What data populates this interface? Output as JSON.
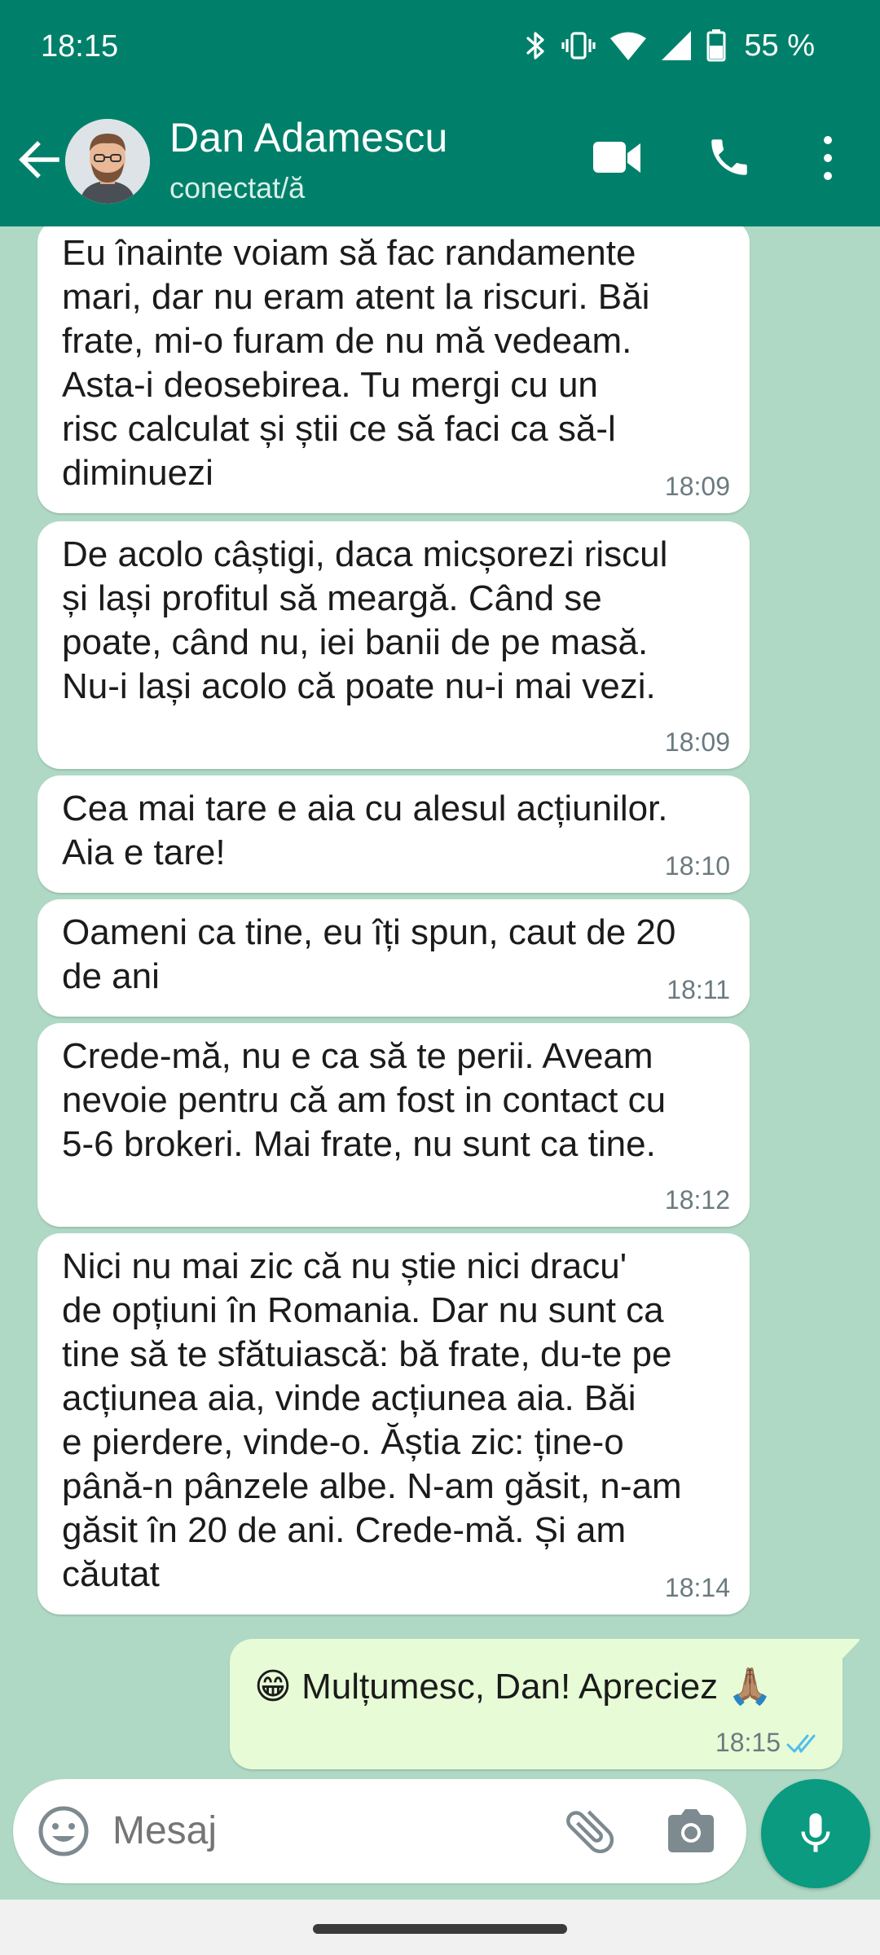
{
  "status_bar": {
    "time": "18:15",
    "battery": "55 %",
    "icons": [
      "bluetooth-icon",
      "vibrate-icon",
      "wifi-icon",
      "cell-signal-icon",
      "battery-icon"
    ]
  },
  "header": {
    "contact_name": "Dan Adamescu",
    "contact_status": "conectat/ă",
    "icons": [
      "back-arrow-icon",
      "avatar",
      "video-call-icon",
      "phone-icon",
      "more-vert-icon"
    ]
  },
  "messages": [
    {
      "direction": "incoming",
      "text": "Eu înainte voiam să fac randamente\nmari, dar nu eram atent la riscuri. Băi\nfrate, mi-o furam de nu mă vedeam.\nAsta-i deosebirea. Tu mergi cu un\nrisc calculat și știi ce să faci ca să-l\ndiminuezi",
      "time": "18:09"
    },
    {
      "direction": "incoming",
      "text": "De acolo câștigi, daca micșorezi riscul\nși lași profitul să meargă. Când se\npoate, când nu, iei banii de pe masă.\nNu-i lași acolo că poate nu-i mai vezi.",
      "time": "18:09"
    },
    {
      "direction": "incoming",
      "text": "Cea mai tare e aia cu alesul acțiunilor.\nAia e tare!",
      "time": "18:10"
    },
    {
      "direction": "incoming",
      "text": "Oameni ca tine, eu îți spun, caut de 20\nde ani",
      "time": "18:11"
    },
    {
      "direction": "incoming",
      "text": "Crede-mă, nu e ca să te perii. Aveam\nnevoie pentru că am fost in contact cu\n5-6 brokeri. Mai frate, nu sunt ca tine.",
      "time": "18:12"
    },
    {
      "direction": "incoming",
      "text": "Nici nu mai zic că nu știe nici dracu'\nde opțiuni în Romania. Dar nu sunt ca\ntine să te sfătuiască: bă frate, du-te pe\nacțiunea aia, vinde acțiunea aia. Băi\ne pierdere, vinde-o. Ăștia zic: ține-o\npână-n pânzele albe. N-am găsit, n-am\ngăsit în 20 de ani. Crede-mă. Și am\ncăutat",
      "time": "18:14"
    },
    {
      "direction": "outgoing",
      "text": "😁 Mulțumesc, Dan! Apreciez 🙏🏽",
      "time": "18:15",
      "read_status": "read-double-check"
    }
  ],
  "input": {
    "placeholder": "Mesaj",
    "icons": [
      "emoji-icon",
      "attach-icon",
      "camera-icon",
      "mic-icon"
    ]
  },
  "colors": {
    "header": "#00806a",
    "chat_background": "#afd9c5",
    "incoming_bubble": "#ffffff",
    "outgoing_bubble": "#e7fcd6",
    "mic_button": "#0a9b80",
    "read_ticks": "#53bdeb"
  }
}
